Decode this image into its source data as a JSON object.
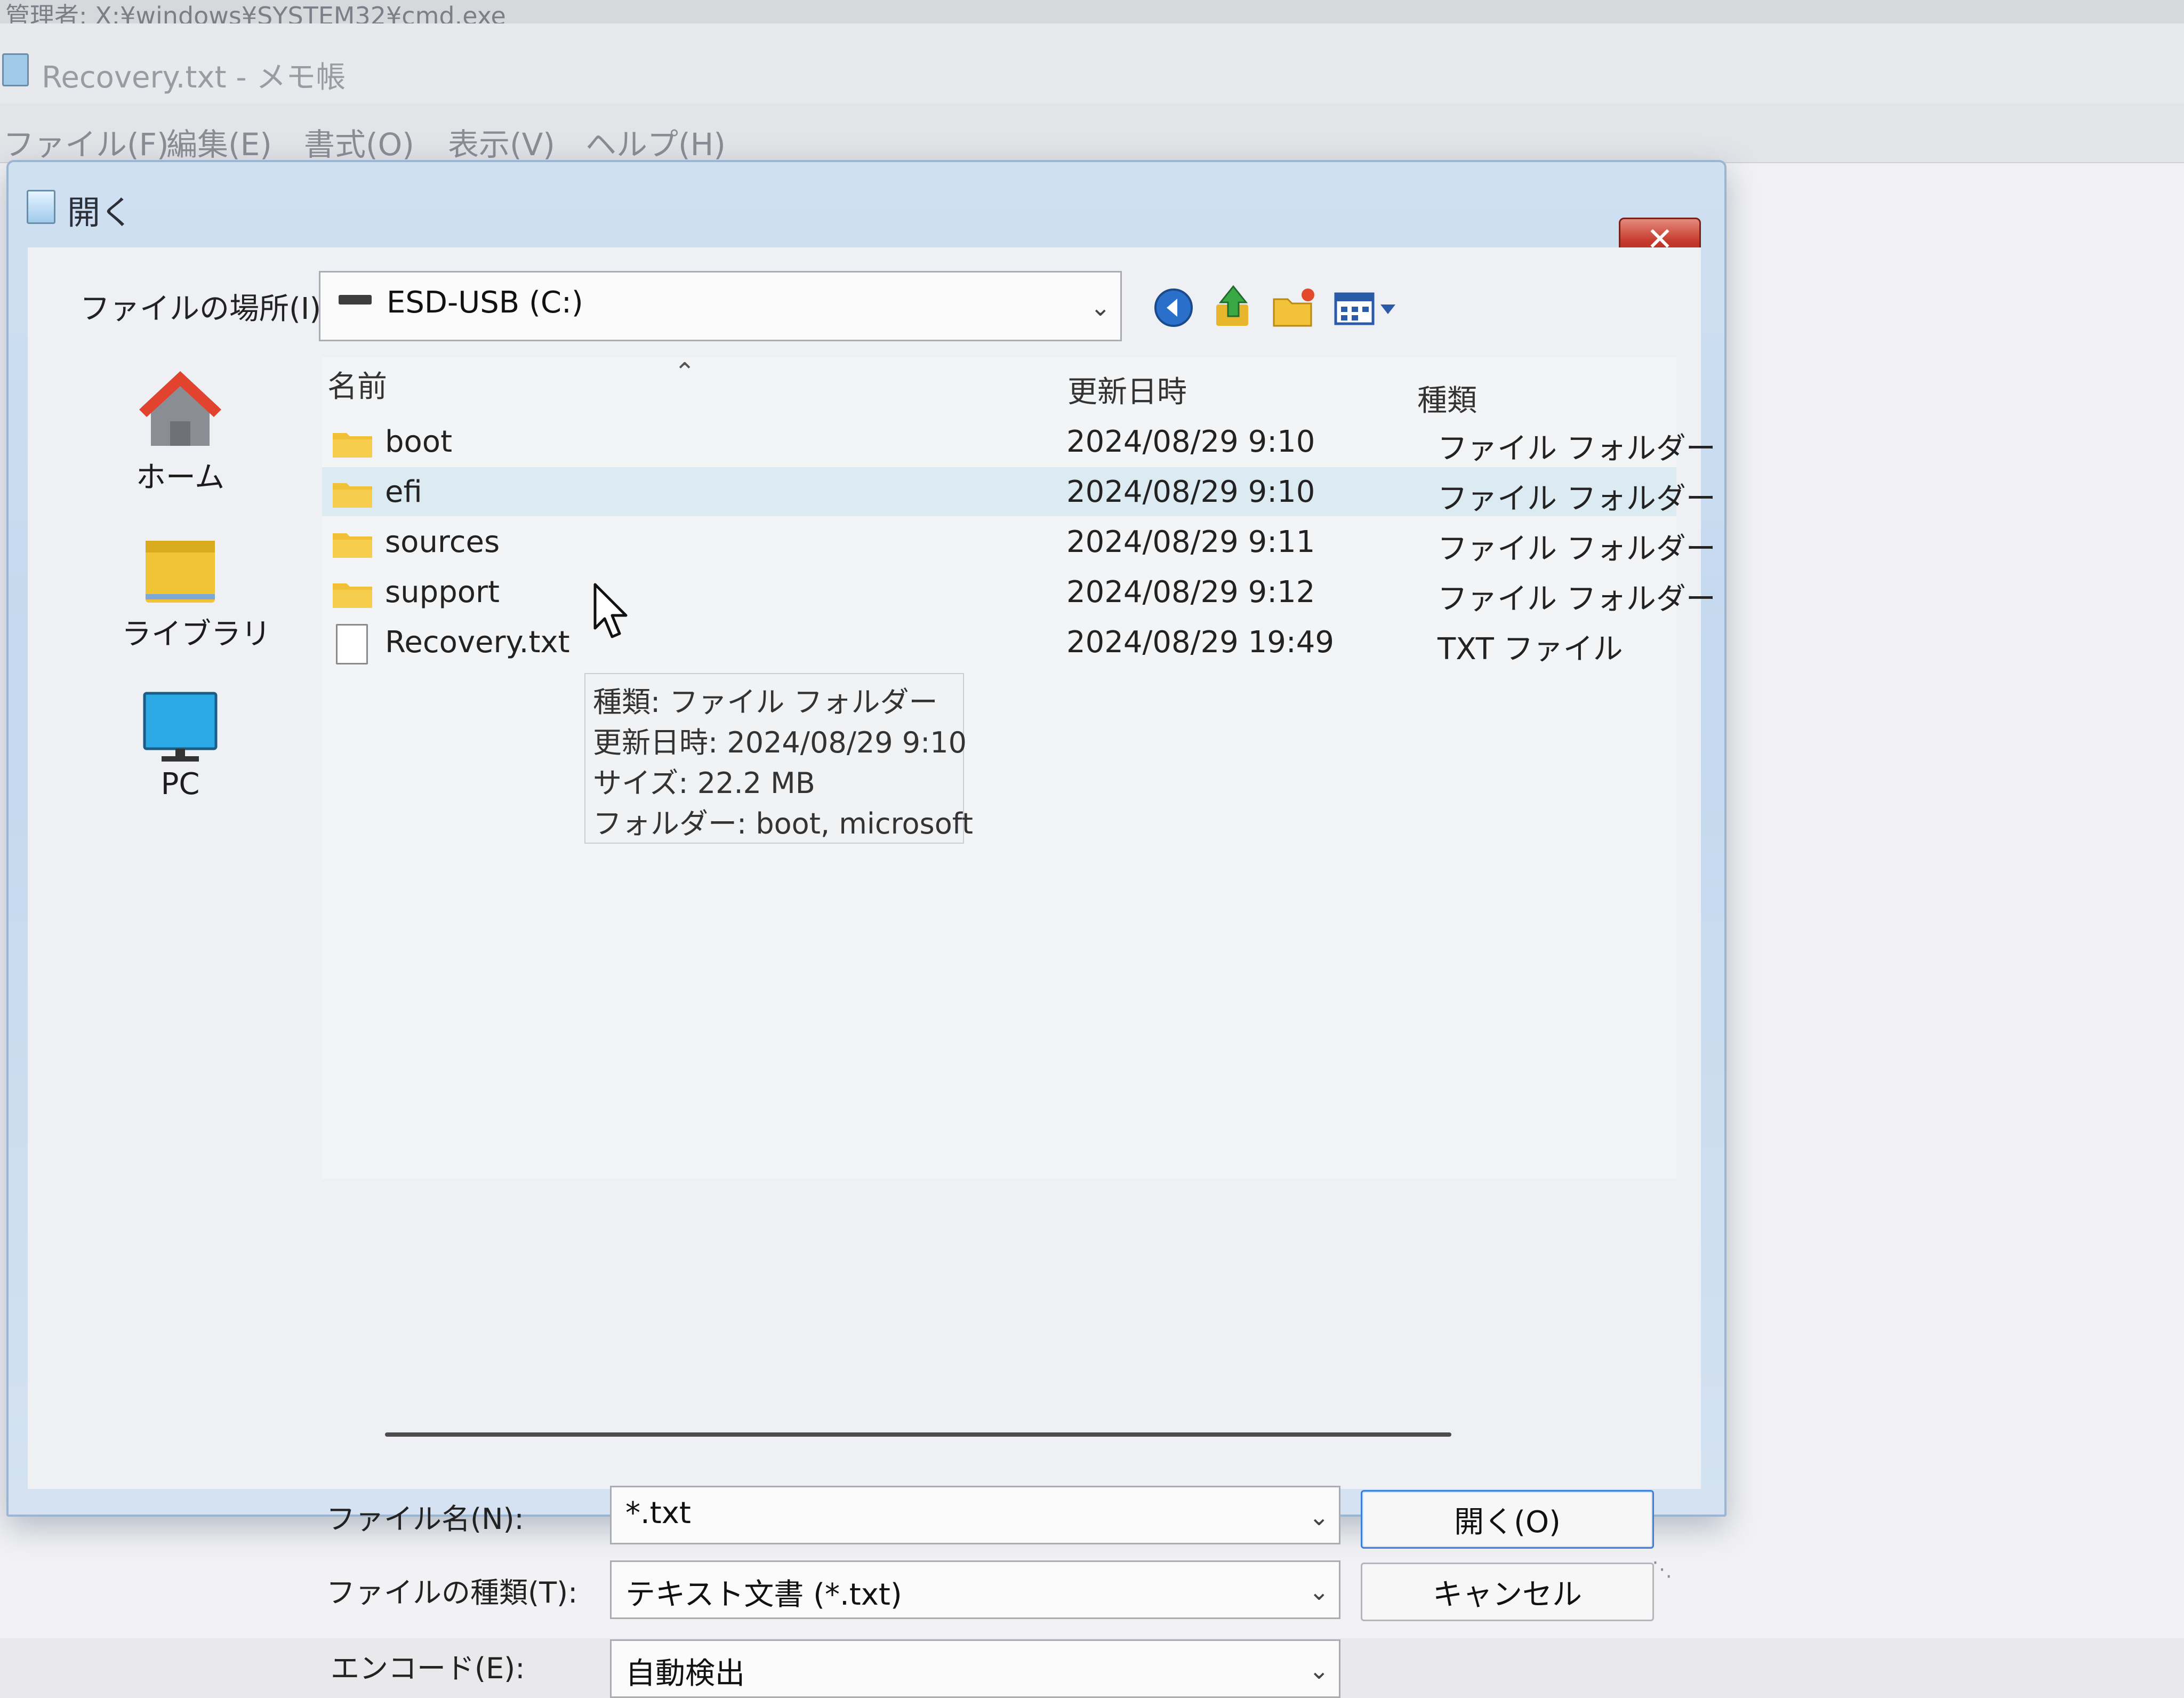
{
  "background": {
    "cmd_title": "管理者: X:¥windows¥SYSTEM32¥cmd.exe",
    "notepad_title": "Recovery.txt - メモ帳",
    "notepad_menu": [
      "ファイル(F)",
      "編集(E)",
      "書式(O)",
      "表示(V)",
      "ヘルプ(H)"
    ]
  },
  "dialog": {
    "title": "開く",
    "close_label": "✕",
    "lookin_label": "ファイルの場所(I):",
    "lookin_value": "ESD-USB (C:)",
    "toolbar_icons": [
      "back-icon",
      "up-folder-icon",
      "new-folder-icon",
      "view-menu-icon"
    ],
    "places": [
      {
        "label": "ホーム",
        "icon": "home-icon"
      },
      {
        "label": "ライブラリ",
        "icon": "library-icon"
      },
      {
        "label": "PC",
        "icon": "pc-icon"
      }
    ],
    "columns": {
      "name": "名前",
      "modified": "更新日時",
      "type": "種類"
    },
    "files": [
      {
        "name": "boot",
        "modified": "2024/08/29 9:10",
        "type": "ファイル フォルダー",
        "icon": "folder-icon"
      },
      {
        "name": "efi",
        "modified": "2024/08/29 9:10",
        "type": "ファイル フォルダー",
        "icon": "folder-icon"
      },
      {
        "name": "sources",
        "modified": "2024/08/29 9:11",
        "type": "ファイル フォルダー",
        "icon": "folder-icon"
      },
      {
        "name": "support",
        "modified": "2024/08/29 9:12",
        "type": "ファイル フォルダー",
        "icon": "folder-icon"
      },
      {
        "name": "Recovery.txt",
        "modified": "2024/08/29 19:49",
        "type": "TXT ファイル",
        "icon": "text-file-icon"
      }
    ],
    "tooltip": [
      "種類: ファイル フォルダー",
      "更新日時: 2024/08/29 9:10",
      "サイズ: 22.2 MB",
      "フォルダー: boot, microsoft"
    ],
    "filename_label": "ファイル名(N):",
    "filename_value": "*.txt",
    "filetype_label": "ファイルの種類(T):",
    "filetype_value": "テキスト文書 (*.txt)",
    "encoding_label": "エンコード(E):",
    "encoding_value": "自動検出",
    "open_button": "開く(O)",
    "cancel_button": "キャンセル",
    "colors": {
      "accent": "#3f7fd8",
      "hover_row": "#dceaf1",
      "close": "#c4392b",
      "folder": "#f2c037"
    }
  }
}
